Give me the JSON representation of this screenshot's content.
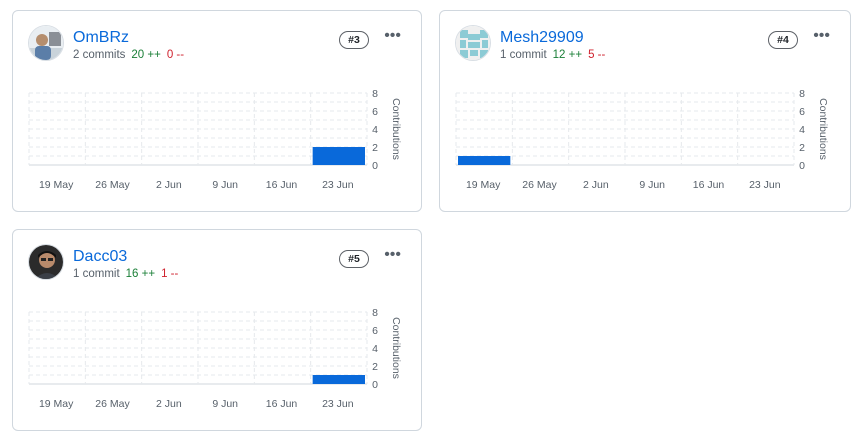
{
  "contributors": [
    {
      "username": "OmBRz",
      "commits": "2 commits",
      "additions": "20 ++",
      "deletions": "0 --",
      "rank": "#3",
      "more_icon": "kebab-horizontal-icon",
      "avatar": "photo",
      "chart_data": {
        "type": "bar",
        "x": [
          "19 May",
          "26 May",
          "2 Jun",
          "9 Jun",
          "16 Jun",
          "23 Jun"
        ],
        "values": [
          0,
          0,
          0,
          0,
          0,
          2
        ],
        "ylabel": "Contributions",
        "yticks": [
          "8",
          "6",
          "4",
          "2",
          "0"
        ],
        "ylim": [
          0,
          8
        ],
        "color": "#0969da"
      }
    },
    {
      "username": "Mesh29909",
      "commits": "1 commit",
      "additions": "12 ++",
      "deletions": "5 --",
      "rank": "#4",
      "more_icon": "kebab-horizontal-icon",
      "avatar": "identicon",
      "chart_data": {
        "type": "bar",
        "x": [
          "19 May",
          "26 May",
          "2 Jun",
          "9 Jun",
          "16 Jun",
          "23 Jun"
        ],
        "values": [
          1,
          0,
          0,
          0,
          0,
          0
        ],
        "ylabel": "Contributions",
        "yticks": [
          "8",
          "6",
          "4",
          "2",
          "0"
        ],
        "ylim": [
          0,
          8
        ],
        "color": "#0969da"
      }
    },
    {
      "username": "Dacc03",
      "commits": "1 commit",
      "additions": "16 ++",
      "deletions": "1 --",
      "rank": "#5",
      "more_icon": "kebab-horizontal-icon",
      "avatar": "photo",
      "chart_data": {
        "type": "bar",
        "x": [
          "19 May",
          "26 May",
          "2 Jun",
          "9 Jun",
          "16 Jun",
          "23 Jun"
        ],
        "values": [
          0,
          0,
          0,
          0,
          0,
          1
        ],
        "ylabel": "Contributions",
        "yticks": [
          "8",
          "6",
          "4",
          "2",
          "0"
        ],
        "ylim": [
          0,
          8
        ],
        "color": "#0969da"
      }
    }
  ]
}
